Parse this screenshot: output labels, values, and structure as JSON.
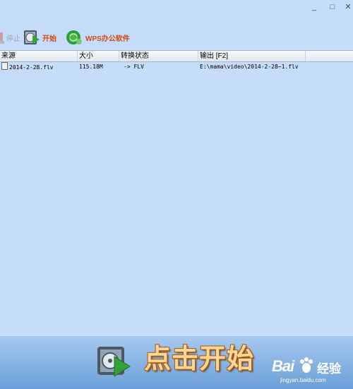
{
  "window": {
    "minimize_glyph": "_",
    "maximize_glyph": "□",
    "close_glyph": "✕"
  },
  "toolbar": {
    "stop_label": "停止",
    "start_label": "开始",
    "wps_label": "WPS办公软件"
  },
  "table": {
    "columns": [
      "来源",
      "大小",
      "转换状态",
      "输出 [F2]"
    ],
    "rows": [
      {
        "source": "2014-2-28.flv",
        "size": "115.18M",
        "status": "-> FLV",
        "output": "E:\\mama\\video\\2014-2-28~1.flv"
      }
    ]
  },
  "footer": {
    "big_start_label": "点击开始",
    "watermark_brand": "Bai",
    "watermark_cn": "经验",
    "watermark_url": "jingyan.baidu.com"
  },
  "colors": {
    "background": "#c6ddf9",
    "accent": "#d44a11",
    "footer": "#6a9fd8"
  }
}
